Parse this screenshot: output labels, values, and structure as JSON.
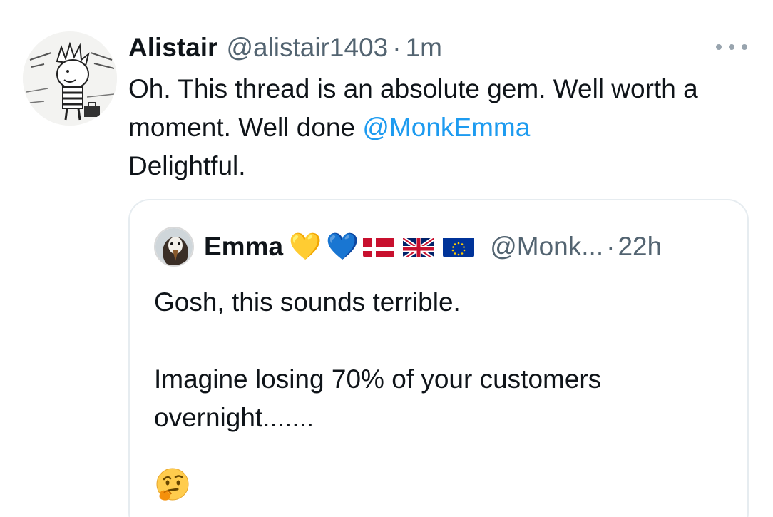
{
  "tweet": {
    "display_name": "Alistair",
    "handle": "@alistair1403",
    "separator": "·",
    "time": "1m",
    "avatar_icon": "comic-boy-avatar",
    "more_icon": "more-options-icon",
    "text_part1": "Oh. This thread is an absolute gem. Well worth a moment. Well done ",
    "mention": "@MonkEmma",
    "text_part2": "Delightful."
  },
  "quote": {
    "display_name": "Emma",
    "emojis": [
      "💛",
      "💙"
    ],
    "flags": [
      "denmark-flag",
      "uk-flag",
      "eu-flag"
    ],
    "handle": "@Monk...",
    "separator": "·",
    "time": "22h",
    "lines": [
      "Gosh, this sounds terrible.",
      "Imagine losing 70% of your customers overnight......."
    ],
    "emoji_end": "🤔"
  },
  "colors": {
    "link": "#1d9bf0",
    "secondary_text": "#536471",
    "primary_text": "#0f1419",
    "card_border": "#e6ecf0"
  }
}
